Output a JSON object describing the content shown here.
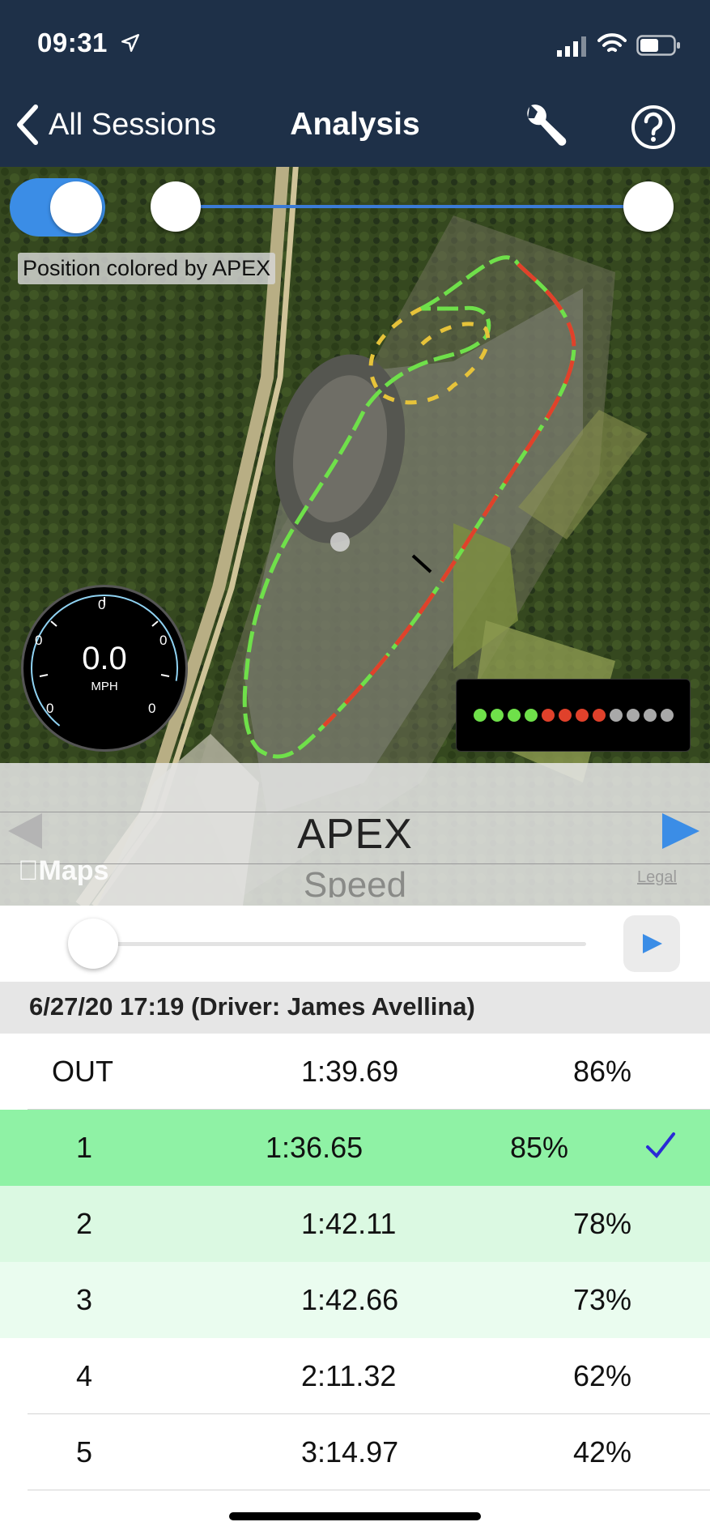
{
  "status_bar": {
    "time": "09:31"
  },
  "nav": {
    "back_label": "All Sessions",
    "title": "Analysis"
  },
  "map": {
    "position_label": "Position colored by APEX",
    "toggle_on": true,
    "gauge": {
      "value": "0.0",
      "unit": "MPH",
      "tick_labels": [
        "0",
        "0",
        "0",
        "0",
        "0"
      ]
    },
    "legend_colors": [
      "#6fe04a",
      "#6fe04a",
      "#6fe04a",
      "#6fe04a",
      "#e0412b",
      "#e0412b",
      "#e0412b",
      "#e0412b",
      "#a9a9a9",
      "#a9a9a9",
      "#a9a9a9",
      "#a9a9a9"
    ],
    "picker": {
      "selected": "APEX",
      "next": "Speed"
    },
    "maps_brand": "Maps",
    "legal": "Legal"
  },
  "session": {
    "header": "6/27/20 17:19 (Driver: James Avellina)"
  },
  "laps": [
    {
      "lap": "OUT",
      "time": "1:39.69",
      "apex": "86%",
      "bg": "#ffffff",
      "selected": false
    },
    {
      "lap": "1",
      "time": "1:36.65",
      "apex": "85%",
      "bg": "#8ff2a5",
      "selected": true
    },
    {
      "lap": "2",
      "time": "1:42.11",
      "apex": "78%",
      "bg": "#dbf9e2",
      "selected": false
    },
    {
      "lap": "3",
      "time": "1:42.66",
      "apex": "73%",
      "bg": "#eafcef",
      "selected": false
    },
    {
      "lap": "4",
      "time": "2:11.32",
      "apex": "62%",
      "bg": "#ffffff",
      "selected": false
    },
    {
      "lap": "5",
      "time": "3:14.97",
      "apex": "42%",
      "bg": "#ffffff",
      "selected": false
    }
  ],
  "colors": {
    "nav_bg": "#1e3048",
    "accent": "#3b8de6",
    "check": "#2a2ad6"
  }
}
